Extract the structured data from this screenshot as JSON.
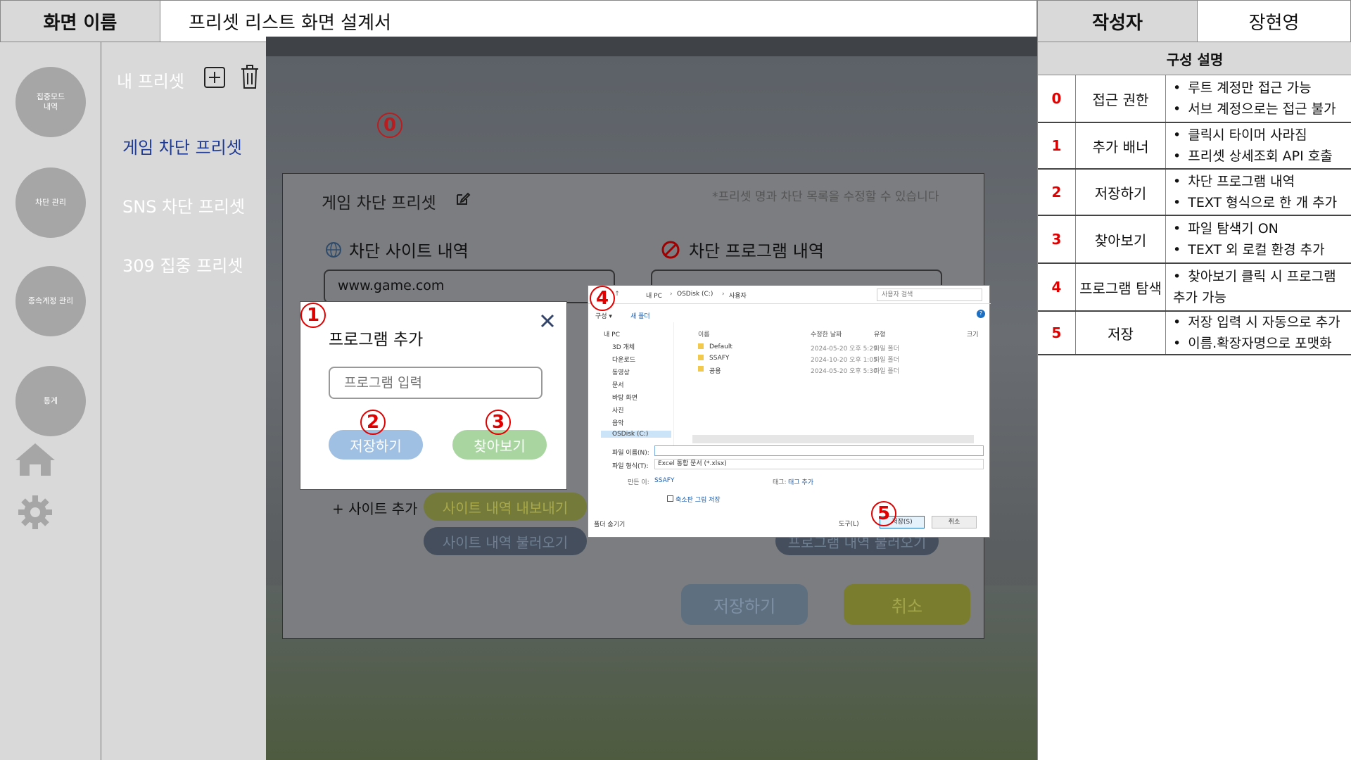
{
  "header": {
    "label": "화면 이름",
    "title": "프리셋 리스트 화면 설계서",
    "author_label": "작성자",
    "author": "장현영"
  },
  "spec": {
    "title": "구성 설명",
    "rows": [
      {
        "num": "0",
        "name": "접근 권한",
        "desc": [
          "루트 계정만 접근 가능",
          "서브 계정으로는 접근 불가"
        ]
      },
      {
        "num": "1",
        "name": "추가 배너",
        "desc": [
          "클릭시 타이머 사라짐",
          "프리셋 상세조회 API 호출"
        ]
      },
      {
        "num": "2",
        "name": "저장하기",
        "desc": [
          "차단 프로그램 내역",
          "TEXT 형식으로 한 개 추가"
        ]
      },
      {
        "num": "3",
        "name": "찾아보기",
        "desc": [
          "파일 탐색기 ON",
          "TEXT 외 로컬 환경 추가"
        ]
      },
      {
        "num": "4",
        "name": "프로그램 탐색",
        "desc": [
          "찾아보기 클릭 시 프로그램 추가 가능"
        ]
      },
      {
        "num": "5",
        "name": "저장",
        "desc": [
          "저장 입력 시 자동으로 추가",
          "이름.확장자명으로 포맷화"
        ]
      }
    ]
  },
  "nav": {
    "items": [
      "집중모드\n내역",
      "차단 관리",
      "종속계정 관리",
      "통계"
    ],
    "home_icon": "home-icon",
    "settings_icon": "gear-icon"
  },
  "submenu": {
    "title": "내 프리셋",
    "presets": [
      "게임 차단 프리셋",
      "SNS 차단 프리셋",
      "309 집중 프리셋"
    ],
    "active_color": "#1f3a93"
  },
  "preset_modal": {
    "title": "게임 차단 프리셋",
    "hint": "*프리셋 명과 차단 목록을 수정할 수 있습니다",
    "site_section": "차단 사이트 내역",
    "program_section": "차단 프로그램 내역",
    "site_value": "www.game.com",
    "add_site": "+ 사이트 추가",
    "export_sites": "사이트 내역 내보내기",
    "import_sites": "사이트 내역 불러오기",
    "import_programs": "프로그램 내역 불러오기",
    "save": "저장하기",
    "cancel": "취소"
  },
  "program_dialog": {
    "title": "프로그램 추가",
    "input_placeholder": "프로그램 입력",
    "save": "저장하기",
    "browse": "찾아보기"
  },
  "file_dialog": {
    "path": [
      "내 PC",
      "OSDisk (C:)",
      "사용자"
    ],
    "search_placeholder": "사용자 검색",
    "organize": "구성 ▾",
    "new_folder": "새 폴더",
    "tree": [
      "내 PC",
      "3D 개체",
      "다운로드",
      "동영상",
      "문서",
      "바탕 화면",
      "사진",
      "음악",
      "OSDisk (C:)"
    ],
    "columns": [
      "이름",
      "수정한 날짜",
      "유형",
      "크기"
    ],
    "files": [
      {
        "name": "Default",
        "date": "2024-05-20 오후 5:29",
        "type": "파일 폴더"
      },
      {
        "name": "SSAFY",
        "date": "2024-10-20 오후 1:05",
        "type": "파일 폴더"
      },
      {
        "name": "공용",
        "date": "2024-05-20 오후 5:30",
        "type": "파일 폴더"
      }
    ],
    "filename_label": "파일 이름(N):",
    "filetype_label": "파일 형식(T):",
    "filetype_value": "Excel 통합 문서 (*.xlsx)",
    "author_label": "만든 이:",
    "author_value": "SSAFY",
    "tag_label": "태그:",
    "tag_value": "태그 추가",
    "thumbnail_label": "축소판 그림 저장",
    "hide_folders": "폴더 숨기기",
    "tools": "도구(L)",
    "save": "저장(S)",
    "cancel": "취소"
  },
  "badges": [
    "0",
    "1",
    "2",
    "3",
    "4",
    "5"
  ]
}
